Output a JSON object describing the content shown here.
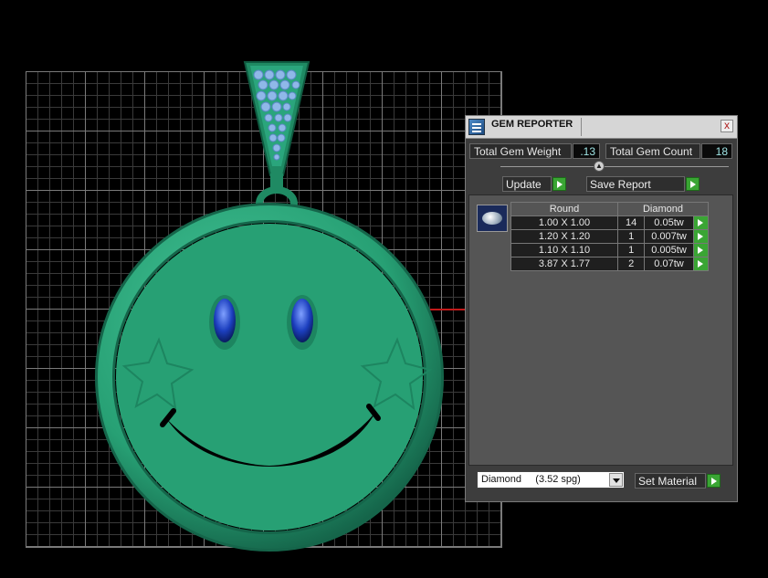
{
  "panel": {
    "title": "GEM REPORTER",
    "close_glyph": "x",
    "total_weight_label": "Total Gem Weight",
    "total_weight_value": ".13",
    "total_count_label": "Total Gem Count",
    "total_count_value": "18",
    "update_label": "Update",
    "save_report_label": "Save Report",
    "table": {
      "headers": [
        "Round",
        "Diamond"
      ],
      "rows": [
        {
          "size": "1.00 X 1.00",
          "count": "14",
          "weight": "0.05tw"
        },
        {
          "size": "1.20 X 1.20",
          "count": "1",
          "weight": "0.007tw"
        },
        {
          "size": "1.10 X 1.10",
          "count": "1",
          "weight": "0.005tw"
        },
        {
          "size": "3.87 X 1.77",
          "count": "2",
          "weight": "0.07tw"
        }
      ]
    },
    "material_select_value": "Diamond     (3.52 spg)",
    "set_material_label": "Set Material"
  },
  "icons": [
    "gem-reporter-icon",
    "close-icon",
    "splitter-arrow-icon",
    "play-arrow-icon",
    "gem-thumbnail",
    "dropdown-caret-icon"
  ],
  "colors": {
    "pendant": "#2aa57c",
    "pendant_dark": "#197a58",
    "eye_gem": "#1c3fbf",
    "bail_gem": "#8fb8e8",
    "axis": "#c21a1a",
    "action_green": "#3aa534",
    "value_text": "#9ee3e3"
  }
}
